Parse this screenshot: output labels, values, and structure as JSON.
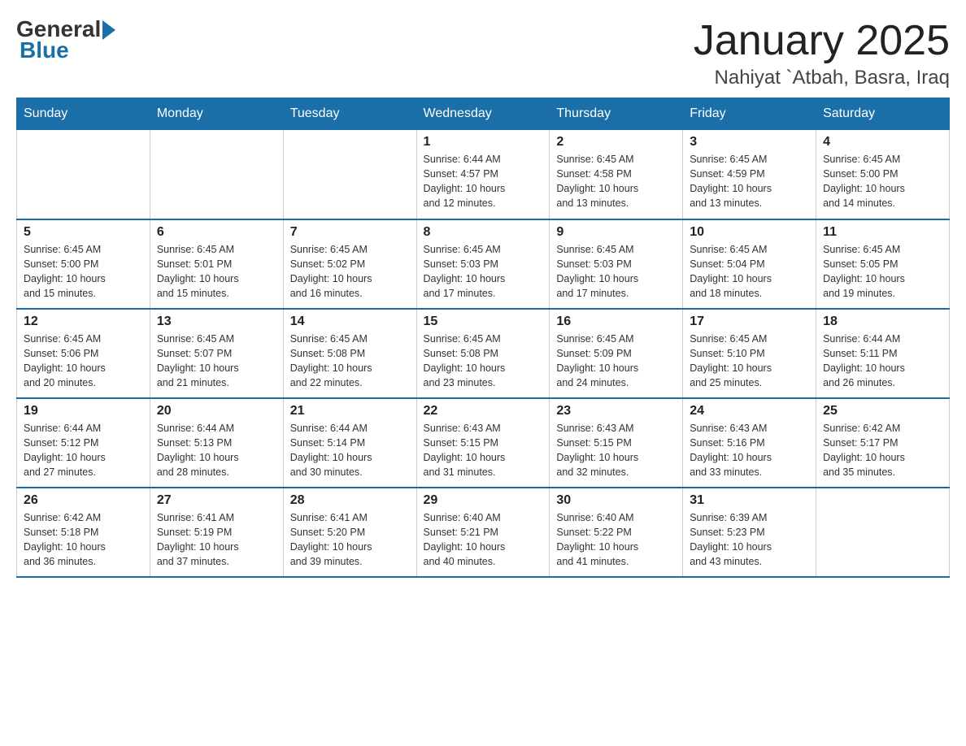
{
  "logo": {
    "general": "General",
    "blue": "Blue"
  },
  "title": "January 2025",
  "location": "Nahiyat `Atbah, Basra, Iraq",
  "days_of_week": [
    "Sunday",
    "Monday",
    "Tuesday",
    "Wednesday",
    "Thursday",
    "Friday",
    "Saturday"
  ],
  "weeks": [
    [
      {
        "day": "",
        "info": ""
      },
      {
        "day": "",
        "info": ""
      },
      {
        "day": "",
        "info": ""
      },
      {
        "day": "1",
        "info": "Sunrise: 6:44 AM\nSunset: 4:57 PM\nDaylight: 10 hours\nand 12 minutes."
      },
      {
        "day": "2",
        "info": "Sunrise: 6:45 AM\nSunset: 4:58 PM\nDaylight: 10 hours\nand 13 minutes."
      },
      {
        "day": "3",
        "info": "Sunrise: 6:45 AM\nSunset: 4:59 PM\nDaylight: 10 hours\nand 13 minutes."
      },
      {
        "day": "4",
        "info": "Sunrise: 6:45 AM\nSunset: 5:00 PM\nDaylight: 10 hours\nand 14 minutes."
      }
    ],
    [
      {
        "day": "5",
        "info": "Sunrise: 6:45 AM\nSunset: 5:00 PM\nDaylight: 10 hours\nand 15 minutes."
      },
      {
        "day": "6",
        "info": "Sunrise: 6:45 AM\nSunset: 5:01 PM\nDaylight: 10 hours\nand 15 minutes."
      },
      {
        "day": "7",
        "info": "Sunrise: 6:45 AM\nSunset: 5:02 PM\nDaylight: 10 hours\nand 16 minutes."
      },
      {
        "day": "8",
        "info": "Sunrise: 6:45 AM\nSunset: 5:03 PM\nDaylight: 10 hours\nand 17 minutes."
      },
      {
        "day": "9",
        "info": "Sunrise: 6:45 AM\nSunset: 5:03 PM\nDaylight: 10 hours\nand 17 minutes."
      },
      {
        "day": "10",
        "info": "Sunrise: 6:45 AM\nSunset: 5:04 PM\nDaylight: 10 hours\nand 18 minutes."
      },
      {
        "day": "11",
        "info": "Sunrise: 6:45 AM\nSunset: 5:05 PM\nDaylight: 10 hours\nand 19 minutes."
      }
    ],
    [
      {
        "day": "12",
        "info": "Sunrise: 6:45 AM\nSunset: 5:06 PM\nDaylight: 10 hours\nand 20 minutes."
      },
      {
        "day": "13",
        "info": "Sunrise: 6:45 AM\nSunset: 5:07 PM\nDaylight: 10 hours\nand 21 minutes."
      },
      {
        "day": "14",
        "info": "Sunrise: 6:45 AM\nSunset: 5:08 PM\nDaylight: 10 hours\nand 22 minutes."
      },
      {
        "day": "15",
        "info": "Sunrise: 6:45 AM\nSunset: 5:08 PM\nDaylight: 10 hours\nand 23 minutes."
      },
      {
        "day": "16",
        "info": "Sunrise: 6:45 AM\nSunset: 5:09 PM\nDaylight: 10 hours\nand 24 minutes."
      },
      {
        "day": "17",
        "info": "Sunrise: 6:45 AM\nSunset: 5:10 PM\nDaylight: 10 hours\nand 25 minutes."
      },
      {
        "day": "18",
        "info": "Sunrise: 6:44 AM\nSunset: 5:11 PM\nDaylight: 10 hours\nand 26 minutes."
      }
    ],
    [
      {
        "day": "19",
        "info": "Sunrise: 6:44 AM\nSunset: 5:12 PM\nDaylight: 10 hours\nand 27 minutes."
      },
      {
        "day": "20",
        "info": "Sunrise: 6:44 AM\nSunset: 5:13 PM\nDaylight: 10 hours\nand 28 minutes."
      },
      {
        "day": "21",
        "info": "Sunrise: 6:44 AM\nSunset: 5:14 PM\nDaylight: 10 hours\nand 30 minutes."
      },
      {
        "day": "22",
        "info": "Sunrise: 6:43 AM\nSunset: 5:15 PM\nDaylight: 10 hours\nand 31 minutes."
      },
      {
        "day": "23",
        "info": "Sunrise: 6:43 AM\nSunset: 5:15 PM\nDaylight: 10 hours\nand 32 minutes."
      },
      {
        "day": "24",
        "info": "Sunrise: 6:43 AM\nSunset: 5:16 PM\nDaylight: 10 hours\nand 33 minutes."
      },
      {
        "day": "25",
        "info": "Sunrise: 6:42 AM\nSunset: 5:17 PM\nDaylight: 10 hours\nand 35 minutes."
      }
    ],
    [
      {
        "day": "26",
        "info": "Sunrise: 6:42 AM\nSunset: 5:18 PM\nDaylight: 10 hours\nand 36 minutes."
      },
      {
        "day": "27",
        "info": "Sunrise: 6:41 AM\nSunset: 5:19 PM\nDaylight: 10 hours\nand 37 minutes."
      },
      {
        "day": "28",
        "info": "Sunrise: 6:41 AM\nSunset: 5:20 PM\nDaylight: 10 hours\nand 39 minutes."
      },
      {
        "day": "29",
        "info": "Sunrise: 6:40 AM\nSunset: 5:21 PM\nDaylight: 10 hours\nand 40 minutes."
      },
      {
        "day": "30",
        "info": "Sunrise: 6:40 AM\nSunset: 5:22 PM\nDaylight: 10 hours\nand 41 minutes."
      },
      {
        "day": "31",
        "info": "Sunrise: 6:39 AM\nSunset: 5:23 PM\nDaylight: 10 hours\nand 43 minutes."
      },
      {
        "day": "",
        "info": ""
      }
    ]
  ]
}
